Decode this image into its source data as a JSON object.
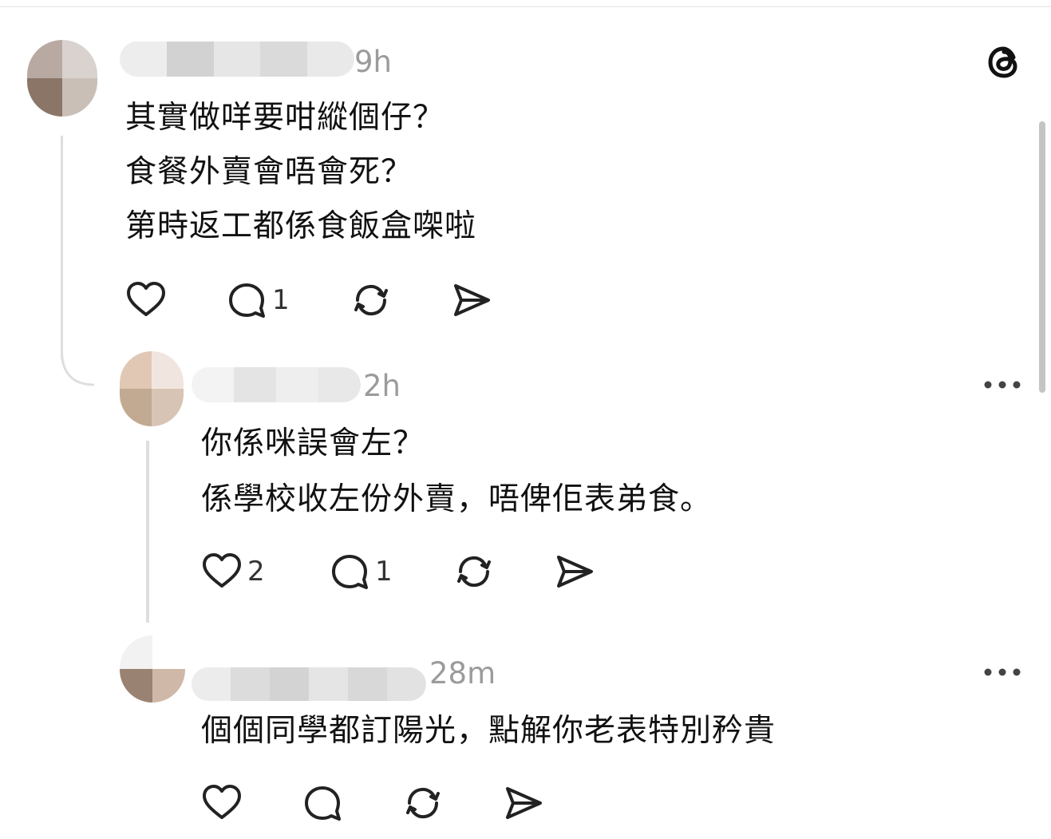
{
  "app": {
    "icon": "threads-logo-icon",
    "accent": "#111111"
  },
  "comments": [
    {
      "time": "9h",
      "lines": [
        "其實做咩要咁縱個仔？",
        "食餐外賣會唔會死？",
        "第時返工都係食飯盒㗎啦"
      ],
      "likes": "",
      "replies": "1",
      "avatar_colors": [
        "#b8aaa3",
        "#d9d2ce",
        "#8a7566",
        "#c9bfb7"
      ]
    },
    {
      "time": "2h",
      "lines": [
        "你係咪誤會左？",
        "係學校收左份外賣，唔俾佢表弟食。"
      ],
      "likes": "2",
      "replies": "1",
      "avatar_colors": [
        "#e0c8b4",
        "#f0e6df",
        "#c2a992",
        "#d7c4b4"
      ]
    },
    {
      "time": "28m",
      "lines": [
        "個個同學都訂陽光，點解你老表特別矜貴"
      ],
      "likes": "",
      "replies": "",
      "avatar_colors": [
        "#f2f2f2",
        "#ffffff",
        "#9a8272",
        "#cfb8a7"
      ]
    }
  ],
  "icons": {
    "like": "heart-icon",
    "reply": "comment-bubble-icon",
    "repost": "repost-icon",
    "share": "send-icon",
    "more": "more-options-icon"
  }
}
